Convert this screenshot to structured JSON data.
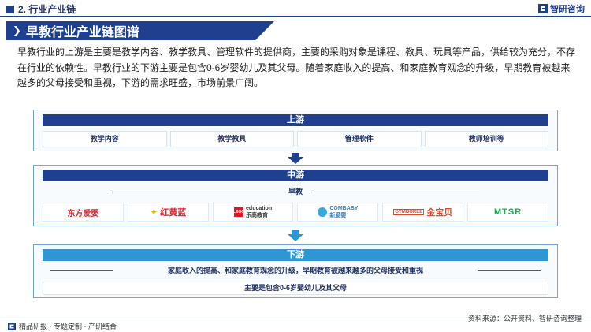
{
  "header": {
    "section_label": "2. 行业产业链",
    "brand_name": "智研咨询"
  },
  "title": "早教行业产业链图谱",
  "intro": "早教行业的上游是主要是教学内容、教学教具、管理软件的提供商，主要的采购对象是课程、教具、玩具等产品，供给较为充分，不存在行业的依赖性。早教行业的下游主要是包含0-6岁婴幼儿及其父母。随着家庭收入的提高、和家庭教育观念的升级，早期教育被越来越多的父母接受和重视，下游的需求旺盛，市场前景广阔。",
  "upstream": {
    "label": "上游",
    "items": [
      "教学内容",
      "教学教具",
      "管理软件",
      "教师培训等"
    ]
  },
  "midstream": {
    "label": "中游",
    "sublabel": "早教",
    "logos": [
      {
        "text": "东方爱婴",
        "icon": "dongfang-aiying-logo"
      },
      {
        "text": "红黄蓝",
        "icon": "honghuanglan-logo"
      },
      {
        "text": "education",
        "icon": "lego-education-logo",
        "sub": "乐高教育",
        "mark": "LEGO"
      },
      {
        "text": "COMBABY",
        "icon": "combaby-logo",
        "sub": "新爱婴"
      },
      {
        "text": "金宝贝",
        "icon": "gymboree-logo",
        "mark": "GYMBOREE"
      },
      {
        "text": "MTSR",
        "icon": "mtsr-logo"
      }
    ]
  },
  "downstream": {
    "label": "下游",
    "sublabel": "家庭收入的提高、和家庭教育观念的升级，早期教育被越来越多的父母接受和重视",
    "item": "主要是包含0-6岁婴幼儿及其父母"
  },
  "footer": {
    "left": "精品研报 · 专题定制 · 产研结合",
    "source": "资料来源：公开资料、智研咨询整理"
  },
  "colors": {
    "primary": "#1f3f8f",
    "downstream_header": "#2f96d6",
    "tier_border": "#6fa7d8"
  }
}
